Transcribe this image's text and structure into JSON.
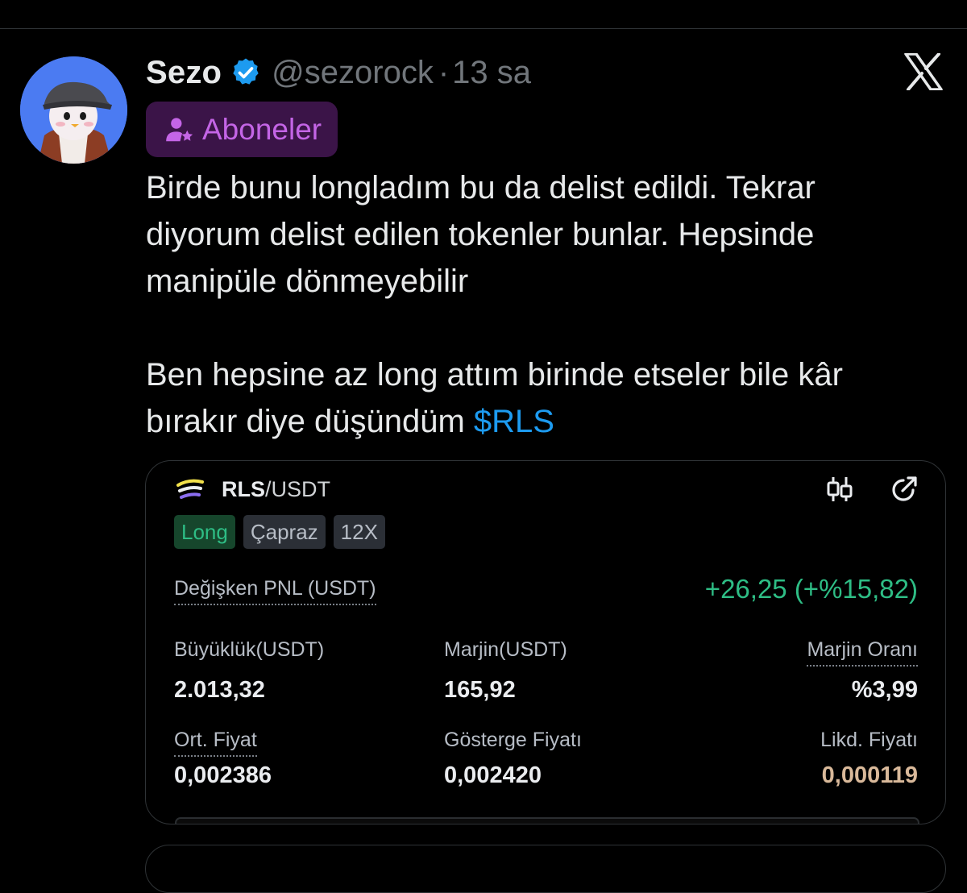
{
  "tweet": {
    "author_name": "Sezo",
    "handle": "@sezorock",
    "separator": "·",
    "time": "13 sa",
    "subscribers_badge": "Aboneler",
    "text_line1": "Birde bunu longladım bu da delist edildi. Tekrar",
    "text_line2": "diyorum delist edilen tokenler bunlar. Hepsinde",
    "text_line3": "manipüle dönmeyebilir",
    "text_line4": "Ben hepsine az long attım birinde etseler bile kâr",
    "text_line5": "bırakır diye düşündüm ",
    "cashtag": "$RLS"
  },
  "icons": {
    "verified": "verified-badge-icon",
    "close": "x-logo-icon",
    "subscribers": "subscriber-star-icon",
    "chart": "candlestick-chart-icon",
    "share": "share-external-icon",
    "token": "rls-token-logo"
  },
  "position_card": {
    "pair_base": "RLS",
    "pair_quote": "/USDT",
    "tags": [
      "Long",
      "Çapraz",
      "12X"
    ],
    "pnl_label": "Değişken PNL (USDT)",
    "pnl_value": "+26,25 (+%15,82)",
    "size_label": "Büyüklük(USDT)",
    "size_value": "2.013,32",
    "margin_label": "Marjin(USDT)",
    "margin_value": "165,92",
    "margin_ratio_label": "Marjin Oranı",
    "margin_ratio_value": "%3,99",
    "entry_label": "Ort. Fiyat",
    "entry_value": "0,002386",
    "mark_label": "Gösterge Fiyatı",
    "mark_value": "0,002420",
    "liq_label": "Likd. Fiyatı",
    "liq_value": "0,000119"
  },
  "colors": {
    "accent_blue": "#1d9bf0",
    "profit_green": "#2ebd85",
    "subscribers_purple": "#c465e6",
    "liq_price": "#d9b99a"
  }
}
